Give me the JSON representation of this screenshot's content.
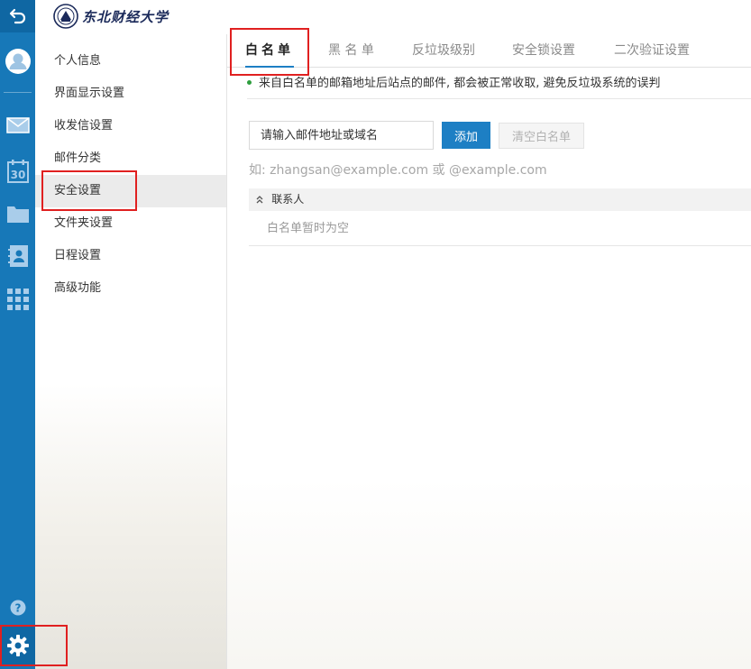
{
  "header": {
    "logo_text": "东北财经大学"
  },
  "appbar": {
    "icons": [
      "back-icon",
      "avatar-icon",
      "mail-icon",
      "calendar-icon",
      "folder-icon",
      "contacts-icon",
      "apps-grid-icon",
      "help-icon",
      "gear-icon"
    ],
    "calendar_day": "30",
    "help_glyph": "?"
  },
  "sidebar": {
    "items": [
      {
        "label": "个人信息"
      },
      {
        "label": "界面显示设置"
      },
      {
        "label": "收发信设置"
      },
      {
        "label": "邮件分类"
      },
      {
        "label": "安全设置"
      },
      {
        "label": "文件夹设置"
      },
      {
        "label": "日程设置"
      },
      {
        "label": "高级功能"
      }
    ],
    "active_index": 4
  },
  "tabs": [
    {
      "label": "白名单"
    },
    {
      "label": "黑 名 单"
    },
    {
      "label": "反垃圾级别"
    },
    {
      "label": "安全锁设置"
    },
    {
      "label": "二次验证设置"
    }
  ],
  "whitelist": {
    "notice": "来自白名单的邮箱地址后站点的邮件, 都会被正常收取, 避免反垃圾系统的误判",
    "input_placeholder": "请输入邮件地址或域名",
    "add_button": "添加",
    "clear_button": "清空白名单",
    "hint": "如: zhangsan@example.com 或 @example.com",
    "group_label": "联系人",
    "empty_text": "白名单暂时为空"
  },
  "colors": {
    "appbar": "#1778b8",
    "accent": "#1d7fc4",
    "highlight": "#e02020"
  }
}
